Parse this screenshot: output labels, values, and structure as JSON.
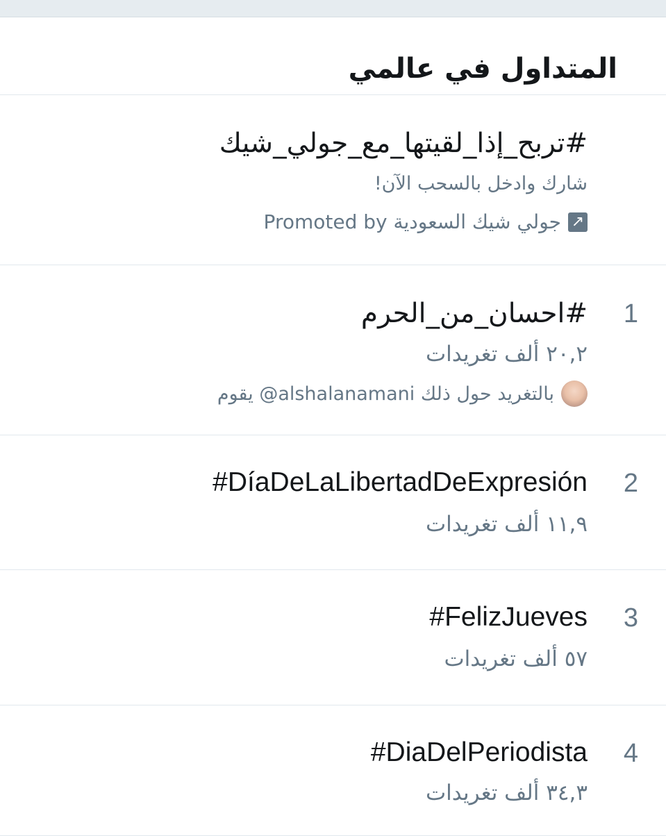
{
  "header": {
    "title": "المتداول في عالمي"
  },
  "promoted": {
    "hashtag": "#تربح_إذا_لقيتها_مع_جولي_شيك",
    "description": "شارك وادخل بالسحب الآن!",
    "promoted_by": "Promoted by جولي شيك السعودية",
    "icon": "promoted-arrow-icon"
  },
  "trends": [
    {
      "rank": "1",
      "name": "#احسان_من_الحرم",
      "count": "٢٠,٢ ألف تغريدات",
      "context": "يقوم @alshalanamani بالتغريد حول ذلك"
    },
    {
      "rank": "2",
      "name": "#DíaDeLaLibertadDeExpresión",
      "count": "١١,٩ ألف تغريدات"
    },
    {
      "rank": "3",
      "name": "#FelizJueves",
      "count": "٥٧ ألف تغريدات"
    },
    {
      "rank": "4",
      "name": "#DiaDelPeriodista",
      "count": "٣٤,٣ ألف تغريدات"
    }
  ],
  "colors": {
    "primary_text": "#14171a",
    "secondary_text": "#657786",
    "divider": "#e1e8ed",
    "top_strip": "#e6ecf0"
  }
}
